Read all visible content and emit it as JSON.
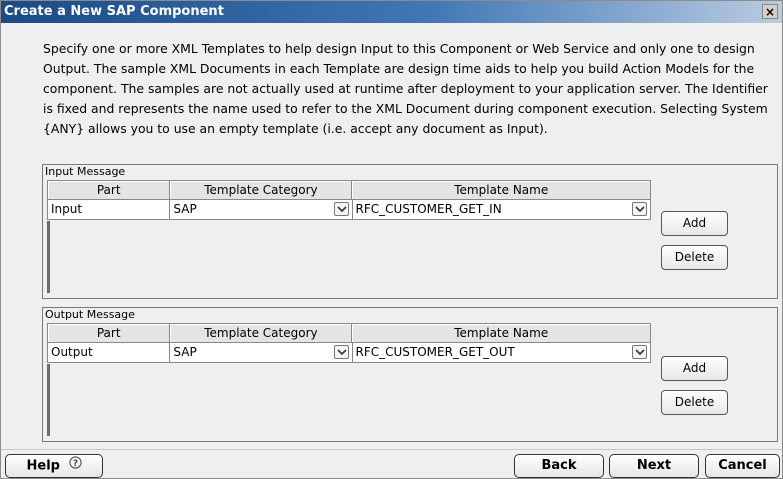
{
  "dialog": {
    "title": "Create a New SAP Component",
    "close_label": "×",
    "description": "Specify one or more XML Templates to help design Input to this Component or Web Service and only one to design Output.  The sample XML Documents in each Template are design time aids to help you build Action Models for the component.  The samples are not actually used at runtime after deployment to your application server.  The Identifier is fixed and represents the name used to refer to the XML Document during component execution.  Selecting System {ANY} allows you to use an empty template (i.e. accept any document as Input)."
  },
  "input_message": {
    "label": "Input Message",
    "columns": [
      "Part",
      "Template Category",
      "Template Name"
    ],
    "rows": [
      {
        "part": "Input",
        "category": "SAP",
        "template": "RFC_CUSTOMER_GET_IN"
      }
    ],
    "add_label": "Add",
    "delete_label": "Delete"
  },
  "output_message": {
    "label": "Output Message",
    "columns": [
      "Part",
      "Template Category",
      "Template Name"
    ],
    "rows": [
      {
        "part": "Output",
        "category": "SAP",
        "template": "RFC_CUSTOMER_GET_OUT"
      }
    ],
    "add_label": "Add",
    "delete_label": "Delete"
  },
  "footer": {
    "help_label": "Help",
    "help_icon": "question-circle-icon",
    "back_label": "Back",
    "next_label": "Next",
    "cancel_label": "Cancel"
  }
}
